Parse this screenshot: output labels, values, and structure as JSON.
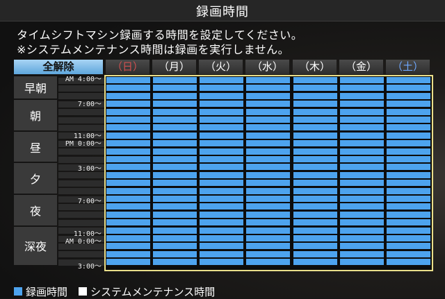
{
  "title": "録画時間",
  "instructions": [
    "タイムシフトマシン録画する時間を設定してください。",
    "※システムメンテナンス時間は録画を実行しません。"
  ],
  "clear_all_label": "全解除",
  "days": [
    {
      "label": "（日）",
      "color": "#d05050"
    },
    {
      "label": "（月）",
      "color": "#ffffff"
    },
    {
      "label": "（火）",
      "color": "#ffffff"
    },
    {
      "label": "（水）",
      "color": "#ffffff"
    },
    {
      "label": "（木）",
      "color": "#ffffff"
    },
    {
      "label": "（金）",
      "color": "#ffffff"
    },
    {
      "label": "（土）",
      "color": "#6fa8ff"
    }
  ],
  "periods": [
    "早朝",
    "朝",
    "昼",
    "夕",
    "夜",
    "深夜"
  ],
  "time_labels": [
    [
      "AM 4:00～"
    ],
    [
      "7:00～"
    ],
    [
      "11:00～",
      "PM 0:00～"
    ],
    [
      "3:00～"
    ],
    [
      "7:00～"
    ],
    [
      "11:00～",
      "AM 0:00～"
    ],
    [
      "3:00～"
    ]
  ],
  "slots_per_day": 24,
  "all_slots_recording": true,
  "legend": {
    "recording": "録画時間",
    "maintenance": "システムメンテナンス時間"
  },
  "colors": {
    "recording": "#4da3ee",
    "maintenance": "#ffffff",
    "grid_border": "#eadf8a",
    "accent": "#6fb6f0"
  }
}
